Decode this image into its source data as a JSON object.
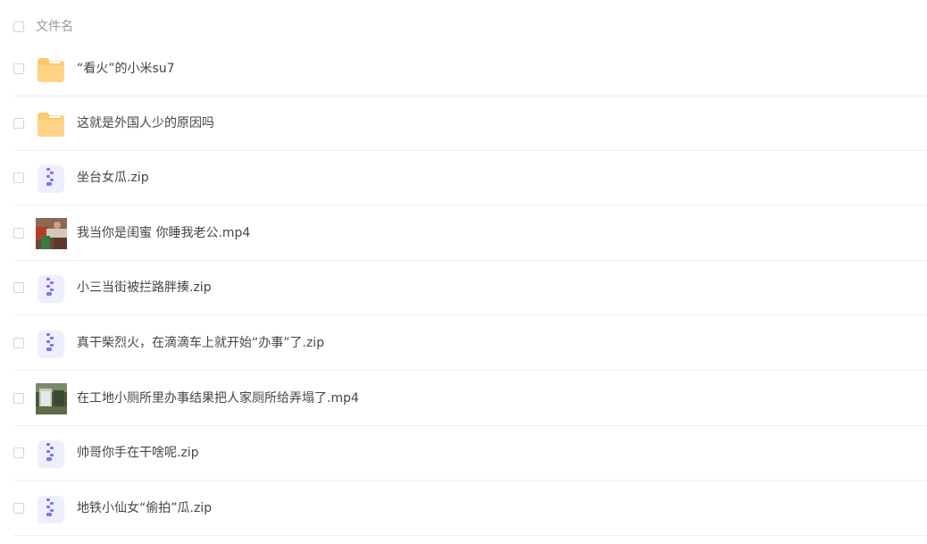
{
  "header": {
    "column_label": "文件名"
  },
  "files": [
    {
      "name": "“看火”的小米su7",
      "type": "folder",
      "icon": "folder-icon"
    },
    {
      "name": "这就是外国人少的原因吗",
      "type": "folder",
      "icon": "folder-icon"
    },
    {
      "name": "坐台女瓜.zip",
      "type": "zip",
      "icon": "zip-icon"
    },
    {
      "name": "我当你是闺蜜 你睡我老公.mp4",
      "type": "video",
      "icon": "video-thumbnail"
    },
    {
      "name": "小三当街被拦路胖揍.zip",
      "type": "zip",
      "icon": "zip-icon"
    },
    {
      "name": "真干柴烈火，在滴滴车上就开始“办事”了.zip",
      "type": "zip",
      "icon": "zip-icon"
    },
    {
      "name": "在工地小厕所里办事结果把人家厕所给弄塌了.mp4",
      "type": "video",
      "icon": "video-thumbnail"
    },
    {
      "name": "帅哥你手在干啥呢.zip",
      "type": "zip",
      "icon": "zip-icon"
    },
    {
      "name": "地铁小仙女“偷拍”瓜.zip",
      "type": "zip",
      "icon": "zip-icon"
    }
  ],
  "colors": {
    "folder": "#FFC96B",
    "zip_bg": "#EEEEFC",
    "zip_mark": "#7B73F6"
  }
}
